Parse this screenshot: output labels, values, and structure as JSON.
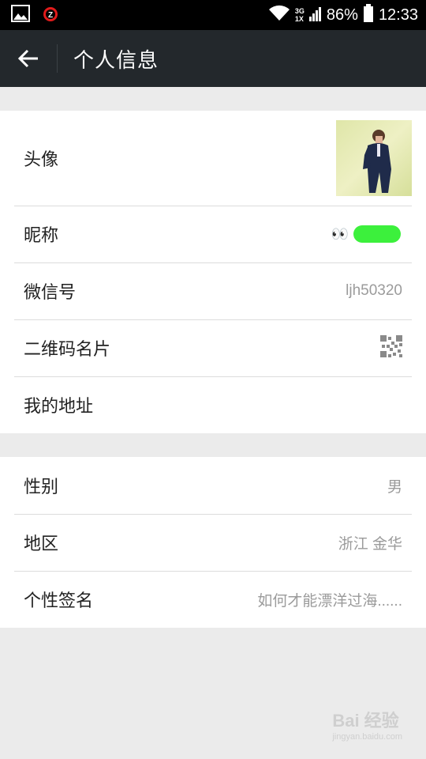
{
  "status_bar": {
    "network_top": "3G",
    "network_bottom": "1X",
    "battery": "86%",
    "time": "12:33"
  },
  "header": {
    "title": "个人信息"
  },
  "profile": {
    "avatar_label": "头像",
    "nickname_label": "昵称",
    "nickname_value": "👀",
    "wechat_id_label": "微信号",
    "wechat_id_value": "ljh50320",
    "qr_label": "二维码名片",
    "address_label": "我的地址"
  },
  "details": {
    "gender_label": "性别",
    "gender_value": "男",
    "region_label": "地区",
    "region_value": "浙江 金华",
    "signature_label": "个性签名",
    "signature_value": "如何才能漂洋过海......"
  },
  "watermark": {
    "brand": "Bai 经验",
    "url": "jingyan.baidu.com"
  },
  "colors": {
    "header_bg": "#23282c",
    "nickname_blob": "#3cf03c"
  }
}
